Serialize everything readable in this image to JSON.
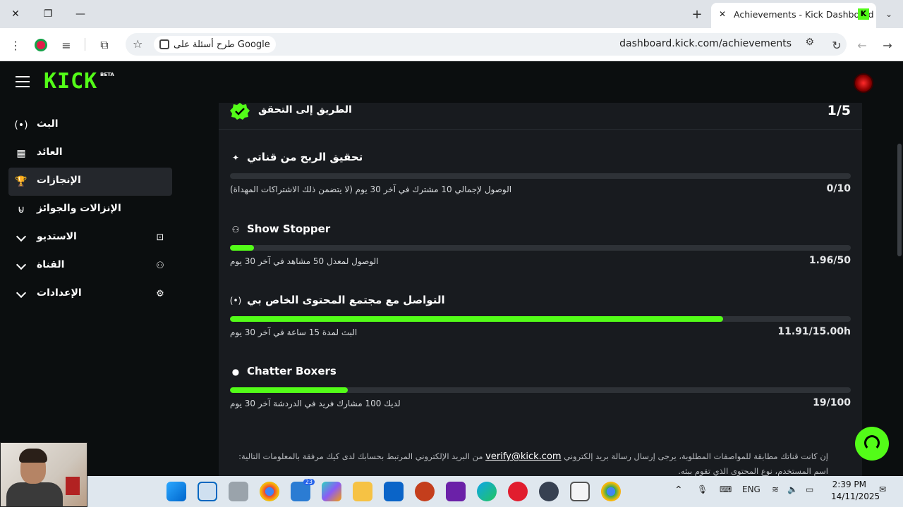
{
  "browser": {
    "tab_title": "Achievements - Kick Dashboard",
    "tab_favicon": "K",
    "url": "dashboard.kick.com/achievements",
    "google_chip": "طرح أسئلة على Google"
  },
  "kick": {
    "logo": "KICK",
    "beta": "BETA",
    "brand_color": "#53fc18"
  },
  "sidebar": {
    "items": [
      {
        "label": "البث",
        "icon": "live-icon"
      },
      {
        "label": "العائد",
        "icon": "chart-icon"
      },
      {
        "label": "الإنجازات",
        "icon": "trophy-icon",
        "active": true
      },
      {
        "label": "الإنزالات والجوائز",
        "icon": "drops-icon"
      },
      {
        "label": "الاستديو",
        "icon": "studio-icon",
        "expandable": true
      },
      {
        "label": "القناة",
        "icon": "channel-icon",
        "expandable": true
      },
      {
        "label": "الإعدادات",
        "icon": "gear-icon",
        "expandable": true
      }
    ]
  },
  "main": {
    "header_title": "الطريق إلى التحقق",
    "header_count": "1/5",
    "achievements": [
      {
        "title": "تحقيق الربح من قناتي",
        "icon": "sparkle-icon",
        "desc": "الوصول لإجمالي 10 مشترك في آخر 30 يوم (لا يتضمن ذلك الاشتراكات المهداة)",
        "value": "0/10",
        "progress": 0.0
      },
      {
        "title": "Show Stopper",
        "icon": "viewers-icon",
        "desc": "الوصول لمعدل 50 مشاهد في آخر 30 يوم",
        "value": "1.96/50",
        "progress": 0.039
      },
      {
        "title": "التواصل مع مجتمع المحتوى الخاص بي",
        "icon": "broadcast-icon",
        "desc": "البث لمدة 15 ساعة في آخر 30 يوم",
        "value": "11.91/15.00h",
        "progress": 0.794
      },
      {
        "title": "Chatter Boxers",
        "icon": "chat-icon",
        "desc": "لديك 100 مشارك فريد في الدردشة آخر 30 يوم",
        "value": "19/100",
        "progress": 0.19
      }
    ],
    "footer_prefix": "إن كانت قناتك مطابقة للمواصفات المطلوبة، يرجى إرسال رسالة بريد إلكتروني",
    "footer_email": "verify@kick.com",
    "footer_suffix": "من البريد الإلكتروني المرتبط بحسابك لدى كيك مرفقة بالمعلومات التالية: اسم المستخدم، نوع المحتوى الذي تقوم ببثه."
  },
  "taskbar": {
    "badge": "23",
    "language": "ENG",
    "time": "2:39 PM",
    "date": "14/11/2025"
  }
}
